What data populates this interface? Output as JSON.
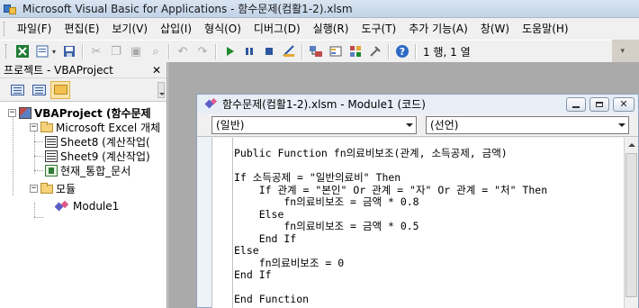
{
  "window": {
    "title": "Microsoft Visual Basic for Applications - 함수문제(컴활1-2).xlsm"
  },
  "menu": [
    "파일(F)",
    "편집(E)",
    "보기(V)",
    "삽입(I)",
    "형식(O)",
    "디버그(D)",
    "실행(R)",
    "도구(T)",
    "추가 기능(A)",
    "창(W)",
    "도움말(H)"
  ],
  "toolbar": {
    "cursor_position": "1 행, 1 열",
    "icons": [
      "excel-icon",
      "insert-module-icon",
      "save-icon",
      "cut-icon",
      "copy-icon",
      "paste-icon",
      "find-icon",
      "undo-icon",
      "redo-icon",
      "run-icon",
      "break-icon",
      "reset-icon",
      "design-mode-icon",
      "project-explorer-icon",
      "properties-icon",
      "object-browser-icon",
      "toolbox-icon",
      "help-icon"
    ]
  },
  "project_panel": {
    "title": "프로젝트 - VBAProject",
    "tree": {
      "project": "VBAProject (함수문제",
      "excel_objects": "Microsoft Excel 개체",
      "sheet8": "Sheet8 (계산작업(",
      "sheet9": "Sheet9 (계산작업)",
      "workbook": "현재_통합_문서",
      "modules": "모듈",
      "module1": "Module1"
    }
  },
  "code_window": {
    "title": "함수문제(컴활1-2).xlsm - Module1 (코드)",
    "object_combo": "(일반)",
    "procedure_combo": "(선언)",
    "lines": [
      "Public Function fn의료비보조(관계, 소득공제, 금액)",
      "",
      "If 소득공제 = \"일반의료비\" Then",
      "    If 관계 = \"본인\" Or 관계 = \"자\" Or 관계 = \"처\" Then",
      "        fn의료비보조 = 금액 * 0.8",
      "    Else",
      "        fn의료비보조 = 금액 * 0.5",
      "    End If",
      "Else",
      "    fn의료비보조 = 0",
      "End If",
      "",
      "End Function"
    ]
  }
}
